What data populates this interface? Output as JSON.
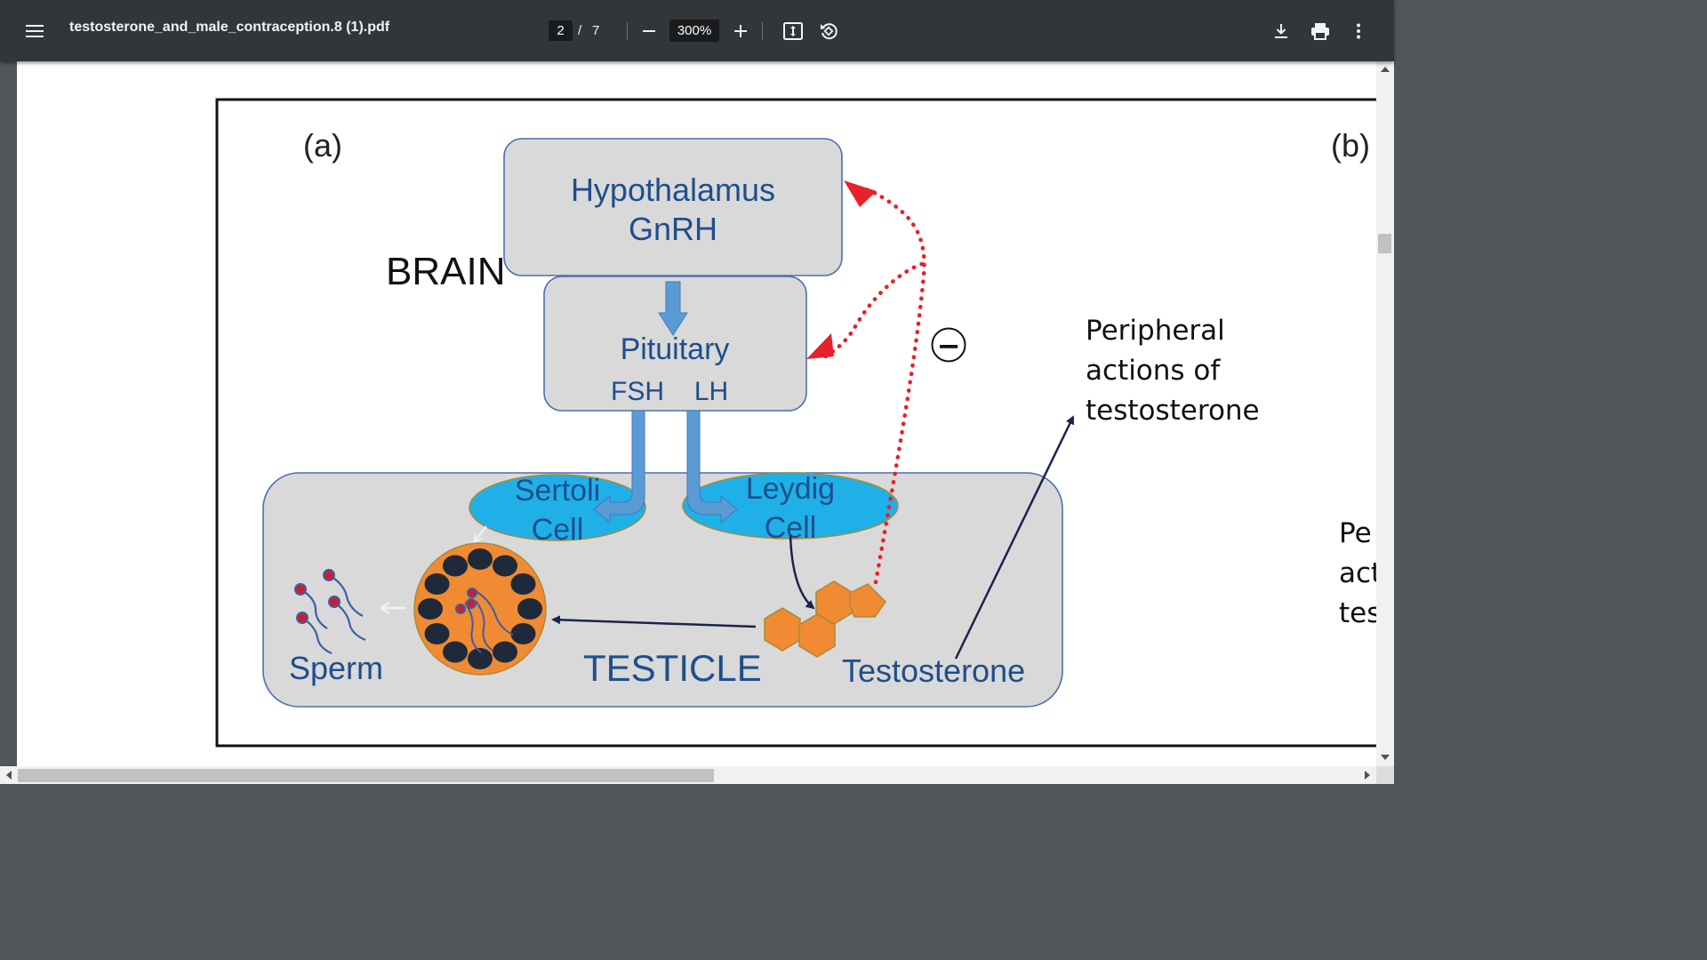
{
  "toolbar": {
    "file_name": "testosterone_and_male_contraception.8 (1).pdf",
    "current_page": "2",
    "page_separator": "/",
    "total_pages": "7",
    "zoom": "300%",
    "icons": [
      "menu-icon",
      "zoom-out-icon",
      "zoom-in-icon",
      "fit-page-icon",
      "rotate-icon",
      "download-icon",
      "print-icon",
      "more-vert-icon"
    ]
  },
  "figure": {
    "panel_a_label": "(a)",
    "panel_b_label": "(b)",
    "brain_label": "BRAIN",
    "hypothalamus": "Hypothalamus",
    "gnrh": "GnRH",
    "pituitary": "Pituitary",
    "fsh": "FSH",
    "lh": "LH",
    "sertoli_1": "Sertoli",
    "sertoli_2": "Cell",
    "leydig_1": "Leydig",
    "leydig_2": "Cell",
    "sperm": "Sperm",
    "testicle": "TESTICLE",
    "testosterone": "Testosterone",
    "feedback_sign": "−",
    "peripheral_1": "Peripheral",
    "peripheral_2": "actions of",
    "peripheral_3": "testosterone",
    "panel_b_text_1": "Pe",
    "panel_b_text_2": "act",
    "panel_b_text_3": "tes"
  },
  "colors": {
    "toolbar_bg": "#323639",
    "box_fill": "#d9d9d9",
    "box_stroke": "#4a6fb0",
    "text_blue": "#1f4e8c",
    "arrow_blue": "#5b9bd5",
    "cell_fill": "#1fb0e8",
    "orange": "#f08a33",
    "feedback_red": "#e8202a",
    "dark_navy": "#1a2350"
  }
}
